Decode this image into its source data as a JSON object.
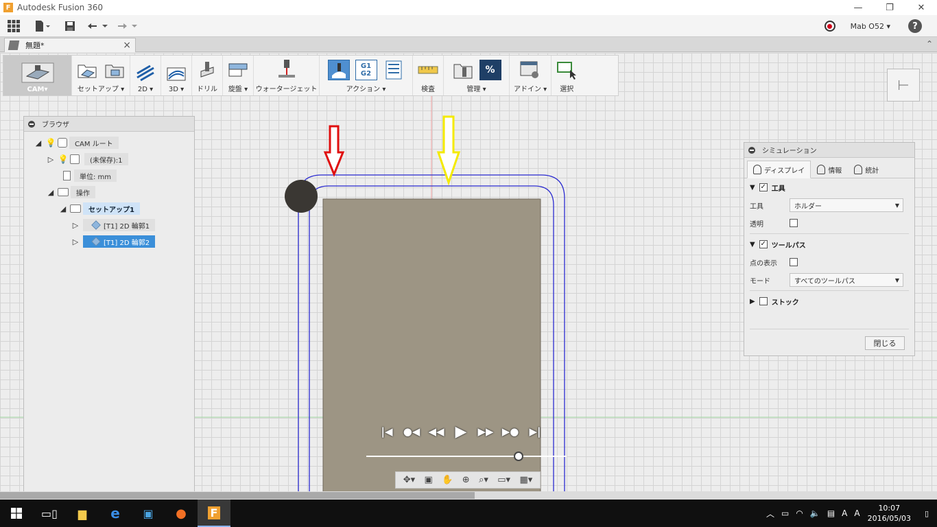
{
  "window": {
    "title": "Autodesk Fusion 360",
    "app_icon": "F"
  },
  "app_toolbar": {
    "user": "Mab O52",
    "help": "?"
  },
  "doc_tab": {
    "name": "無題*",
    "close": "×"
  },
  "ribbon": {
    "workspace": "CAM▾",
    "groups": [
      {
        "label": "セットアップ ▾"
      },
      {
        "label": "2D ▾"
      },
      {
        "label": "3D ▾"
      },
      {
        "label": "ドリル"
      },
      {
        "label": "旋盤 ▾"
      },
      {
        "label": "ウォータージェット"
      },
      {
        "label": "アクション ▾"
      },
      {
        "label": "検査"
      },
      {
        "label": "管理 ▾"
      },
      {
        "label": "アドイン ▾"
      },
      {
        "label": "選択"
      }
    ],
    "g1g2": [
      "G1",
      "G2"
    ],
    "percent": "%"
  },
  "browser": {
    "title": "ブラウザ",
    "nodes": [
      {
        "label": "CAM ルート"
      },
      {
        "label": "(未保存):1"
      },
      {
        "label": "単位: mm"
      },
      {
        "label": "操作"
      },
      {
        "label": "セットアップ1"
      },
      {
        "label": "[T1] 2D 輪郭1"
      },
      {
        "label": "[T1] 2D 輪郭2"
      }
    ]
  },
  "simulation": {
    "title": "シミュレーション",
    "tabs": [
      "ディスプレイ",
      "情報",
      "統計"
    ],
    "sections": {
      "tool": {
        "label": "工具",
        "checked": true
      },
      "toolpath": {
        "label": "ツールパス",
        "checked": true
      },
      "stock": {
        "label": "ストック",
        "checked": false
      }
    },
    "fields": {
      "tool_label": "工具",
      "tool_value": "ホルダー",
      "transparent_label": "透明",
      "points_label": "点の表示",
      "mode_label": "モード",
      "mode_value": "すべてのツールパス"
    },
    "close": "閉じる"
  },
  "taskbar": {
    "time": "10:07",
    "date": "2016/05/03"
  },
  "colors": {
    "stock": "#9d9584",
    "toolpath": "#2a2ad0",
    "arrow_red": "#e01010",
    "arrow_yellow": "#f4ea00",
    "tool_ball": "#3a3733",
    "selection": "#3b8fd9"
  }
}
